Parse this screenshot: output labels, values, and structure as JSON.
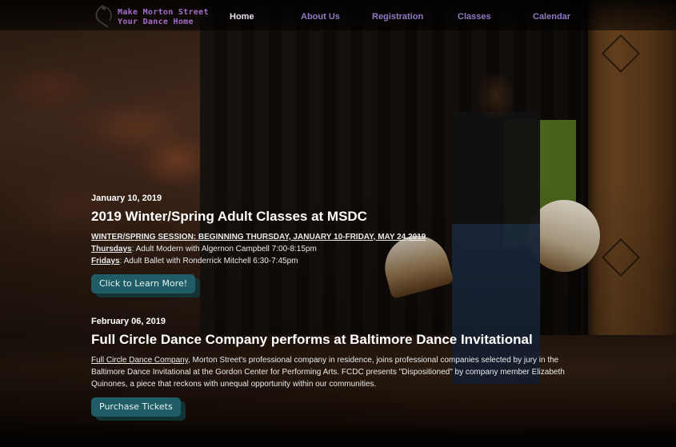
{
  "header": {
    "logo_line1": "Make Morton Street",
    "logo_line2": "Your Dance Home",
    "nav": [
      {
        "label": "Home",
        "active": true
      },
      {
        "label": "About Us",
        "active": false
      },
      {
        "label": "Registration",
        "active": false
      },
      {
        "label": "Classes",
        "active": false
      },
      {
        "label": "Calendar",
        "active": false
      }
    ]
  },
  "posts": [
    {
      "date": "January 10, 2019",
      "title": "2019 Winter/Spring Adult Classes at MSDC",
      "session_line": "WINTER/SPRING SESSION: BEGINNING THURSDAY, JANUARY 10-FRIDAY, MAY 24,2019",
      "line2_label": "Thursdays",
      "line2_text": ": Adult Modern with Algernon Campbell 7:00-8:15pm",
      "line3_label": "Fridays",
      "line3_text": ": Adult Ballet with Ronderrick Mitchell 6:30-7:45pm",
      "cta_label": "Click to Learn More!"
    },
    {
      "date": "February 06, 2019",
      "title": "Full Circle Dance Company performs at Baltimore Dance Invitational",
      "link_text": "Full Circle Dance Company",
      "body_text": ", Morton Street's professional company in residence, joins professional companies selected by jury in the Baltimore Dance Invitational at the Gordon Center for Performing Arts. FCDC presents \"Dispositioned\" by company member Elizabeth Quinones, a piece that reckons with unequal opportunity within our communities.",
      "cta_label": "Purchase Tickets"
    }
  ],
  "colors": {
    "nav_text": "#8f7ac4",
    "nav_active": "#e6dff0",
    "logo_text": "#a36ec8",
    "button_bg": "#1f5c66"
  }
}
